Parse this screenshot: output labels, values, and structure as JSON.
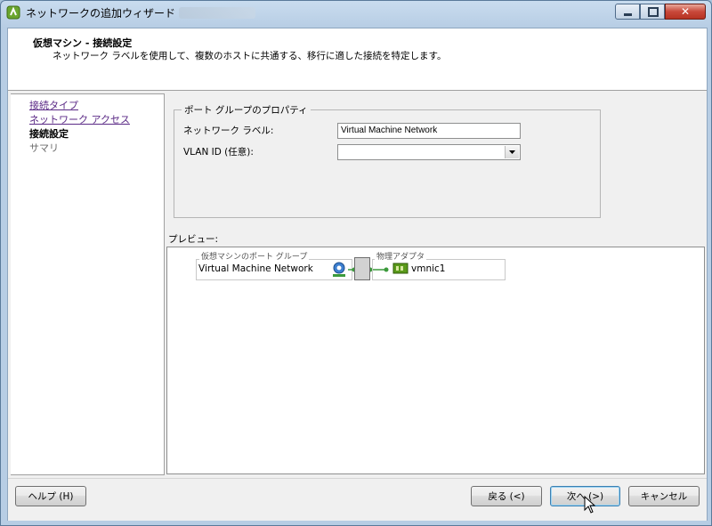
{
  "window": {
    "title": "ネットワークの追加ウィザード",
    "close_glyph": "✕"
  },
  "header": {
    "title": "仮想マシン - 接続設定",
    "description": "ネットワーク ラベルを使用して、複数のホストに共通する、移行に適した接続を特定します。"
  },
  "nav": {
    "items": [
      {
        "label": "接続タイプ",
        "state": "link"
      },
      {
        "label": "ネットワーク アクセス",
        "state": "link"
      },
      {
        "label": "接続設定",
        "state": "current"
      },
      {
        "label": "サマリ",
        "state": "future"
      }
    ]
  },
  "properties": {
    "legend": "ポート グループのプロパティ",
    "network_label_caption": "ネットワーク ラベル:",
    "network_label_value": "Virtual Machine Network",
    "vlan_caption": "VLAN ID (任意):",
    "vlan_value": ""
  },
  "preview": {
    "label": "プレビュー:",
    "port_group_caption": "仮想マシンのポート グループ",
    "port_group_name": "Virtual Machine Network",
    "adapter_caption": "物理アダプタ",
    "adapter_name": "vmnic1"
  },
  "buttons": {
    "help": "ヘルプ (H)",
    "back": "戻る (<)",
    "next": "次へ (>)",
    "cancel": "キャンセル"
  },
  "colors": {
    "link": "#5b2a86",
    "connector": "#3c9a3c",
    "nic": "#5a9a1a",
    "close_button": "#c8483a"
  }
}
